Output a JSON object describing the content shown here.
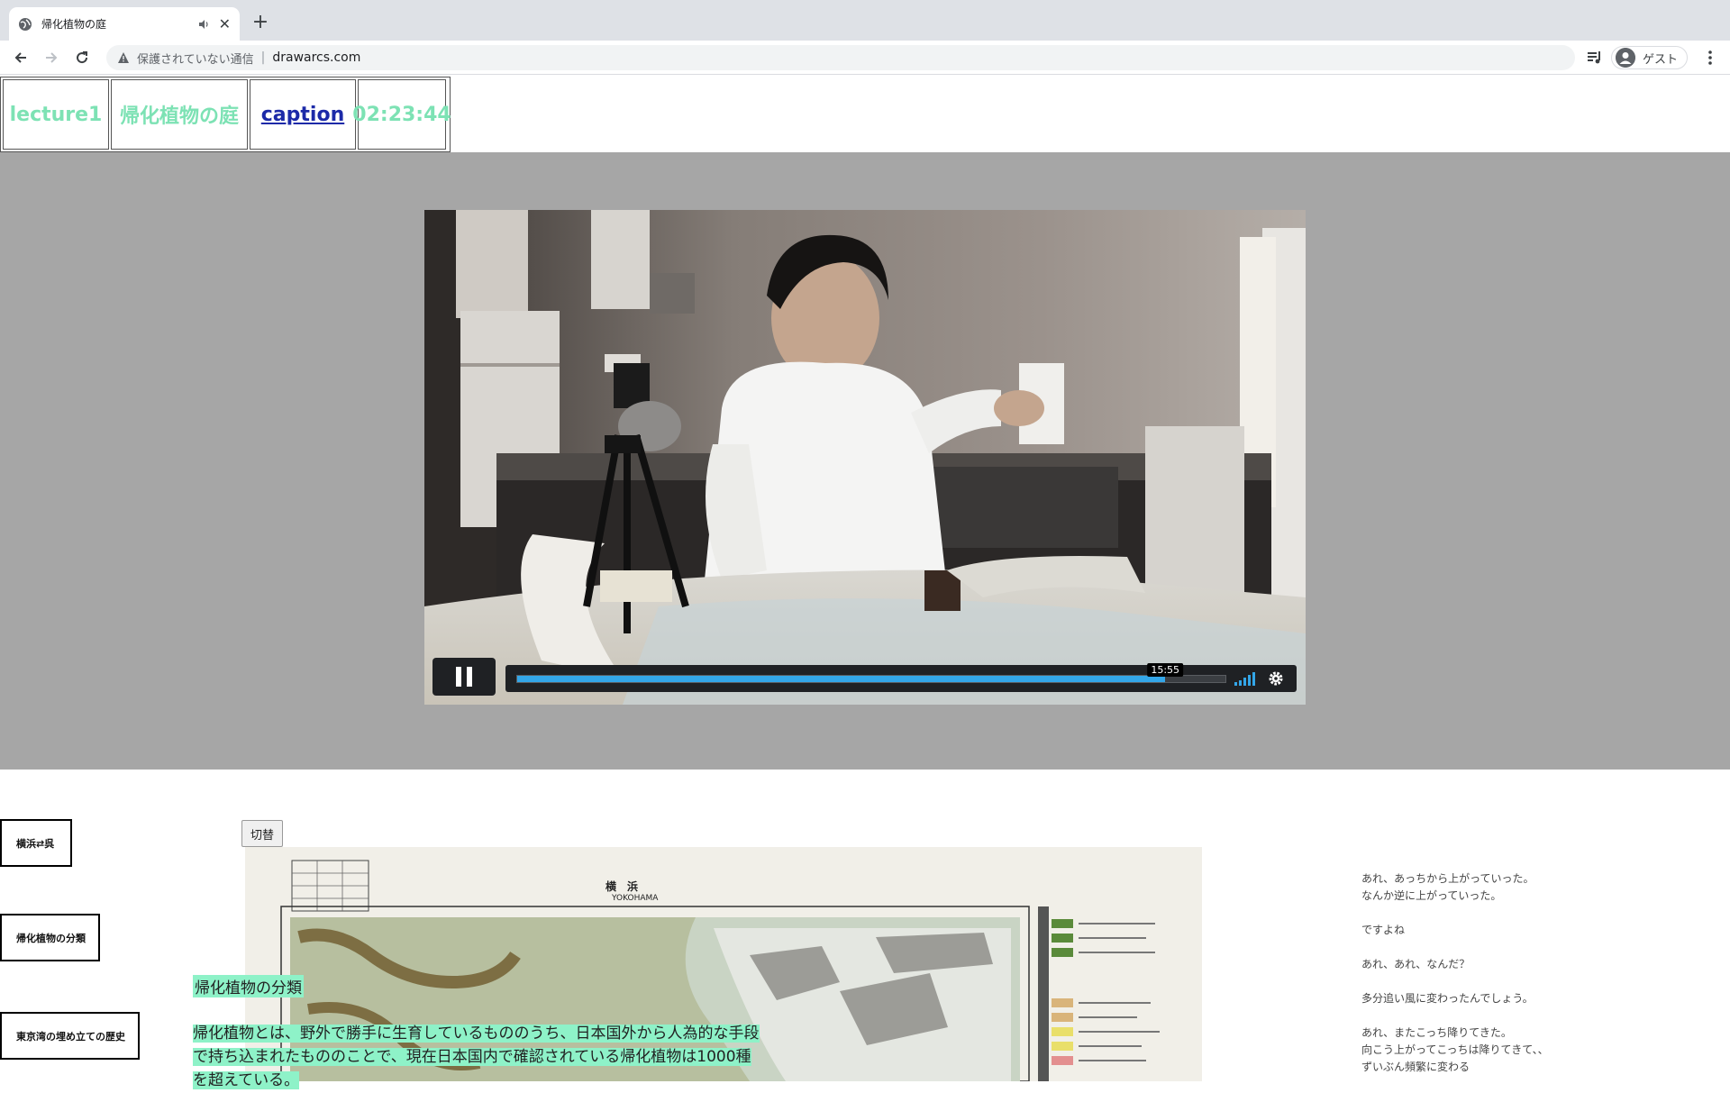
{
  "browser": {
    "tab_title": "帰化植物の庭",
    "new_tab": "+",
    "close_symbol": "✕",
    "security_label": "保護されていない通信",
    "separator": "|",
    "url": "drawarcs.com",
    "profile_label": "ゲスト"
  },
  "page_nav": {
    "items": [
      {
        "label": "lecture1",
        "width": 118
      },
      {
        "label": "帰化植物の庭",
        "width": 152
      },
      {
        "label": "caption",
        "width": 118,
        "is_link": true
      },
      {
        "label": "02:23:44",
        "width": 98
      }
    ]
  },
  "video": {
    "timestamp": "15:55",
    "progress": 0.915,
    "accent_color": "#33a6e8"
  },
  "sections": [
    {
      "label": "横浜⇄呉"
    },
    {
      "label": "帰化植物の分類"
    },
    {
      "label": "東京湾の埋め立ての歴史"
    }
  ],
  "toggle_label": "切替",
  "map": {
    "title_jp": "横　浜",
    "title_en": "YOKOHAMA"
  },
  "overlay": {
    "heading": "帰化植物の分類",
    "body_lines": [
      "帰化植物とは、野外で勝手に生育しているもののうち、日本国外から人為的な手段",
      "で持ち込まれたもののことで、現在日本国内で確認されている帰化植物は1000種",
      "を超えている。"
    ]
  },
  "captions": [
    "あれ、あっちから上がっていった。\nなんか逆に上がっていった。",
    "ですよね",
    "あれ、あれ、なんだ？",
    "多分追い風に変わったんでしょう。",
    "あれ、またこっち降りてきた。\n向こう上がってこっちは降りてきて、、\nずいぶん頻繁に変わる"
  ]
}
